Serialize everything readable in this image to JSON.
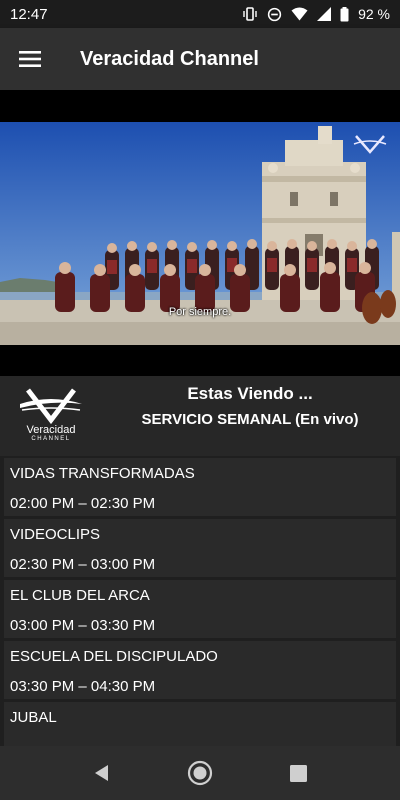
{
  "status_bar": {
    "time": "12:47",
    "battery": "92 %",
    "icons": [
      "vibrate-icon",
      "do-not-disturb-icon",
      "wifi-icon",
      "signal-icon",
      "battery-icon"
    ]
  },
  "app_bar": {
    "title": "Veracidad Channel",
    "menu_icon": "hamburger-menu-icon"
  },
  "video": {
    "subtitle": "Por siempre."
  },
  "now_playing": {
    "logo_text": "Veracidad",
    "logo_subtext": "CHANNEL",
    "heading": "Estas Viendo ...",
    "program": "SERVICIO SEMANAL (En vivo)"
  },
  "schedule": [
    {
      "name": "VIDAS TRANSFORMADAS",
      "time": "02:00 PM – 02:30 PM"
    },
    {
      "name": "VIDEOCLIPS",
      "time": "02:30 PM – 03:00 PM"
    },
    {
      "name": "EL CLUB DEL ARCA",
      "time": "03:00 PM – 03:30 PM"
    },
    {
      "name": "ESCUELA DEL DISCIPULADO",
      "time": "03:30 PM – 04:30 PM"
    },
    {
      "name": "JUBAL",
      "time": ""
    }
  ],
  "nav_bar": {
    "icons": [
      "back-icon",
      "home-icon",
      "recents-icon"
    ]
  },
  "colors": {
    "app_bar": "#303030",
    "background": "#1f1f1f",
    "card": "#2a2a2a"
  }
}
